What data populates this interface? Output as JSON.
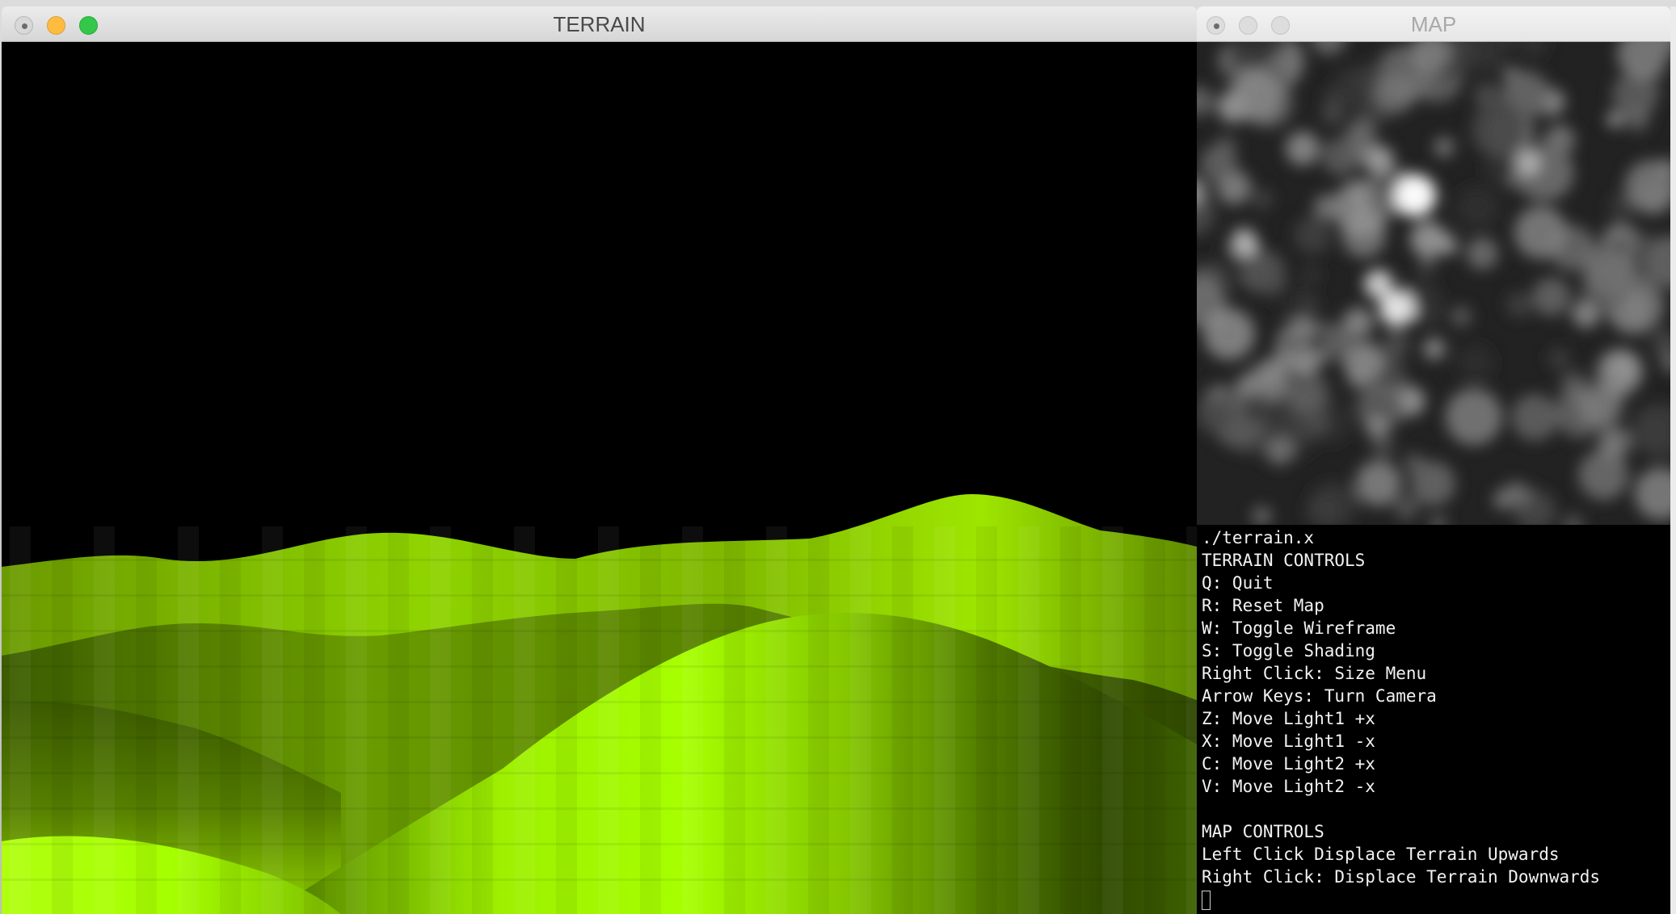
{
  "terrain_window": {
    "title": "TERRAIN",
    "controls": [
      "close-button",
      "minimize-button",
      "maximize-button"
    ],
    "colors": {
      "background": "#000000",
      "terrain_light": "#a4ff00",
      "terrain_dark": "#2b4200"
    }
  },
  "map_window": {
    "title": "MAP",
    "controls": [
      "close-button",
      "minimize-button",
      "maximize-button"
    ],
    "image": "grayscale-noise-heightmap"
  },
  "terminal": {
    "lines": [
      "./terrain.x",
      "TERRAIN CONTROLS",
      "Q: Quit",
      "R: Reset Map",
      "W: Toggle Wireframe",
      "S: Toggle Shading",
      "Right Click: Size Menu",
      "Arrow Keys: Turn Camera",
      "Z: Move Light1 +x",
      "X: Move Light1 -x",
      "C: Move Light2 +x",
      "V: Move Light2 -x",
      "",
      "MAP CONTROLS",
      "Left Click Displace Terrain Upwards",
      "Right Click: Displace Terrain Downwards"
    ]
  }
}
